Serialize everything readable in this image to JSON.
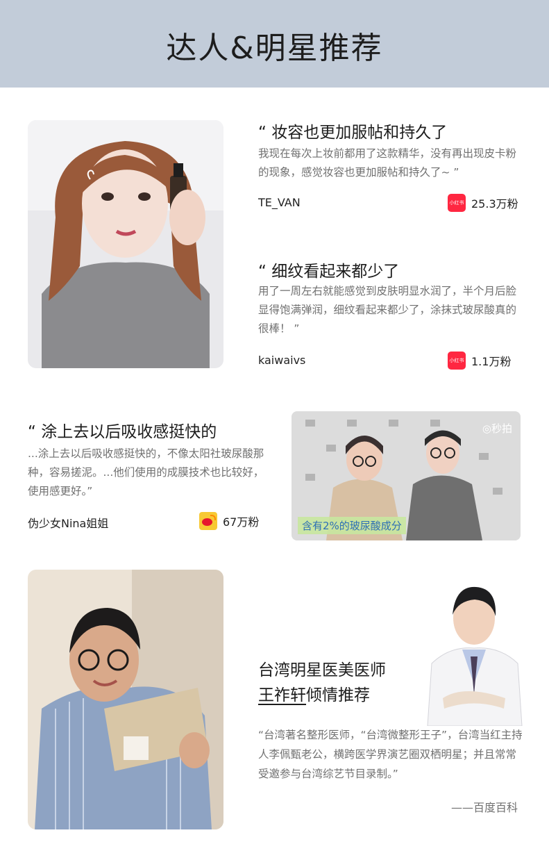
{
  "header": {
    "title": "达人&明星推荐"
  },
  "reviews": [
    {
      "title": "“ 妆容也更加服帖和持久了",
      "body": "我现在每次上妆前都用了这款精华，没有再出现皮卡粉的现象，感觉妆容也更加服帖和持久了~ ”",
      "user": "TE_VAN",
      "platform_icon": "xiaohongshu-icon",
      "platform_text": "小红书",
      "fans": "25.3万粉"
    },
    {
      "title": "“ 细纹看起来都少了",
      "body": "用了一周左右就能感觉到皮肤明显水润了，半个月后脸显得饱满弹润，细纹看起来都少了，涂抹式玻尿酸真的很棒！ ”",
      "user": "kaiwaivs",
      "platform_icon": "xiaohongshu-icon",
      "platform_text": "小红书",
      "fans": "1.1万粉"
    },
    {
      "title": "“ 涂上去以后吸收感挺快的",
      "body": "...涂上去以后吸收感挺快的，不像太阳社玻尿酸那种，容易搓泥。...他们使用的成膜技术也比较好，使用感更好。”",
      "user": "伪少女Nina姐姐",
      "platform_icon": "weibo-icon",
      "fans": "67万粉"
    }
  ],
  "video": {
    "caption": "含有2%的玻尿酸成分",
    "logo": "◎秒拍"
  },
  "doctor": {
    "line1": "台湾明星医美医师",
    "name": "王祚轩",
    "line2_suffix": "倾情推荐",
    "body": "“台湾著名整形医师，“台湾微整形王子”，台湾当红主持人李佩甄老公，横跨医学界演艺圈双栖明星；并且常常受邀参与台湾综艺节目录制。”",
    "source": "——百度百科"
  },
  "colors": {
    "header_bg": "#c2ccd9",
    "xiaohongshu": "#ff2741",
    "weibo_yellow": "#f7c934",
    "caption_text": "#2d6fb5"
  }
}
